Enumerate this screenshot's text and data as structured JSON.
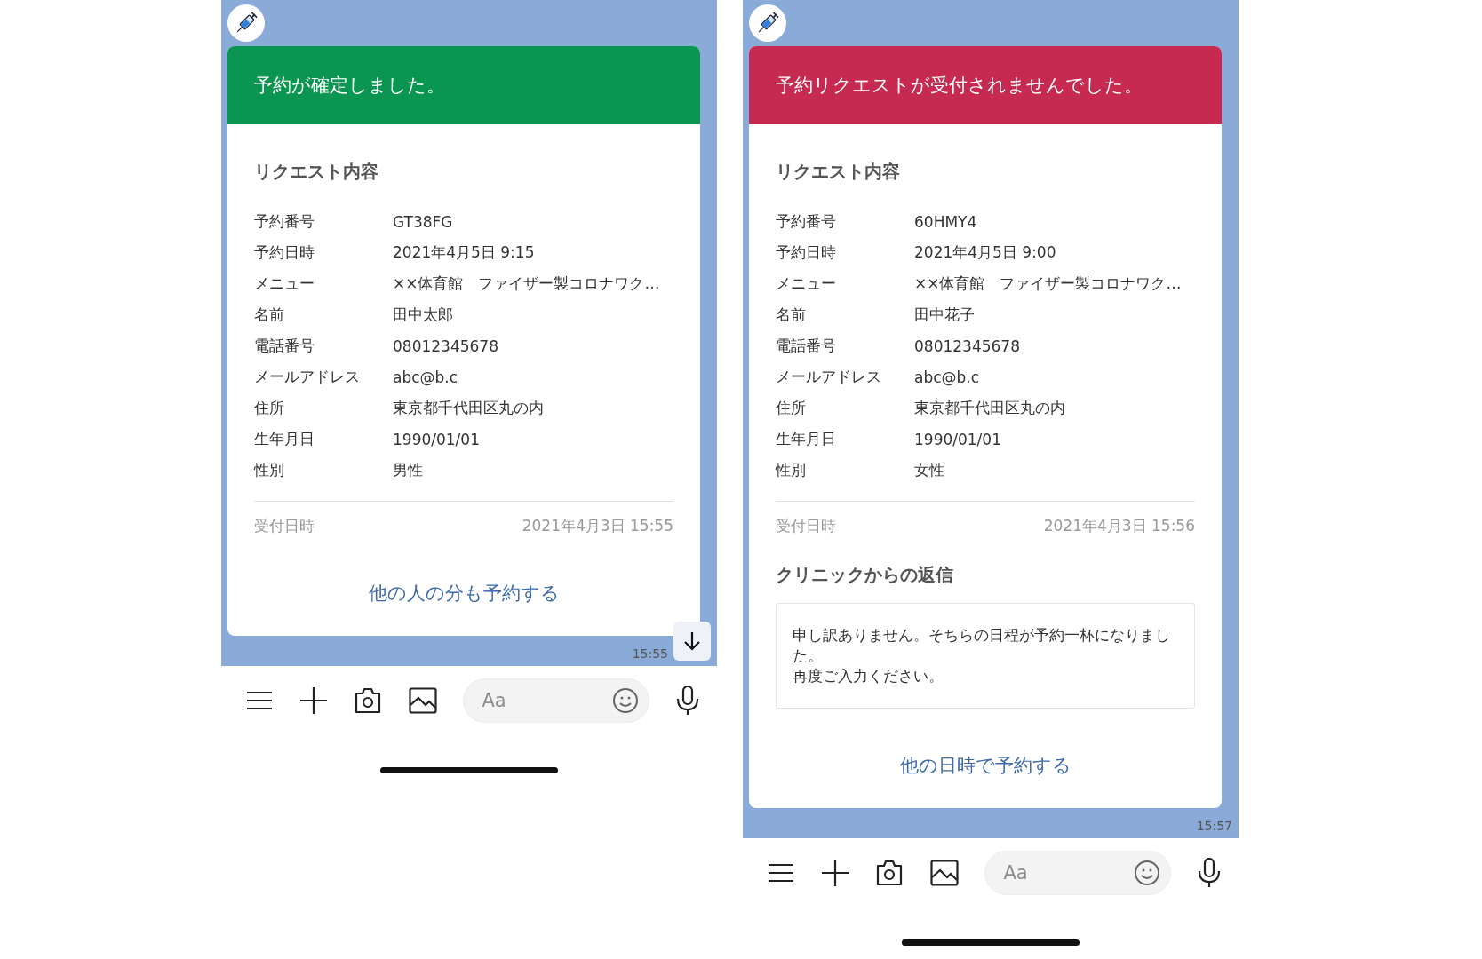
{
  "phones": [
    {
      "header": {
        "kind": "confirmed",
        "text": "予約が確定しました。"
      },
      "section_title": "リクエスト内容",
      "rows": [
        {
          "label": "予約番号",
          "value": "GT38FG"
        },
        {
          "label": "予約日時",
          "value": "2021年4月5日 9:15"
        },
        {
          "label": "メニュー",
          "value": "××体育館　ファイザー製コロナワク…"
        },
        {
          "label": "名前",
          "value": "田中太郎"
        },
        {
          "label": "電話番号",
          "value": "08012345678"
        },
        {
          "label": "メールアドレス",
          "value": "abc@b.c"
        },
        {
          "label": "住所",
          "value": "東京都千代田区丸の内"
        },
        {
          "label": "生年月日",
          "value": "1990/01/01"
        },
        {
          "label": "性別",
          "value": "男性"
        }
      ],
      "received": {
        "label": "受付日時",
        "value": "2021年4月3日 15:55"
      },
      "action_link": "他の人の分も予約する",
      "time": "15:55",
      "scroll_down_button": true,
      "composer": {
        "placeholder": "Aa"
      }
    },
    {
      "header": {
        "kind": "rejected",
        "text": "予約リクエストが受付されませんでした。"
      },
      "section_title": "リクエスト内容",
      "rows": [
        {
          "label": "予約番号",
          "value": "60HMY4"
        },
        {
          "label": "予約日時",
          "value": "2021年4月5日 9:00"
        },
        {
          "label": "メニュー",
          "value": "××体育館　ファイザー製コロナワク…"
        },
        {
          "label": "名前",
          "value": "田中花子"
        },
        {
          "label": "電話番号",
          "value": "08012345678"
        },
        {
          "label": "メールアドレス",
          "value": "abc@b.c"
        },
        {
          "label": "住所",
          "value": "東京都千代田区丸の内"
        },
        {
          "label": "生年月日",
          "value": "1990/01/01"
        },
        {
          "label": "性別",
          "value": "女性"
        }
      ],
      "received": {
        "label": "受付日時",
        "value": "2021年4月3日 15:56"
      },
      "reply": {
        "title": "クリニックからの返信",
        "lines": [
          "申し訳ありません。そちらの日程が予約一杯になりました。",
          "再度ご入力ください。"
        ]
      },
      "action_link": "他の日時で予約する",
      "time": "15:57",
      "composer": {
        "placeholder": "Aa"
      }
    }
  ]
}
